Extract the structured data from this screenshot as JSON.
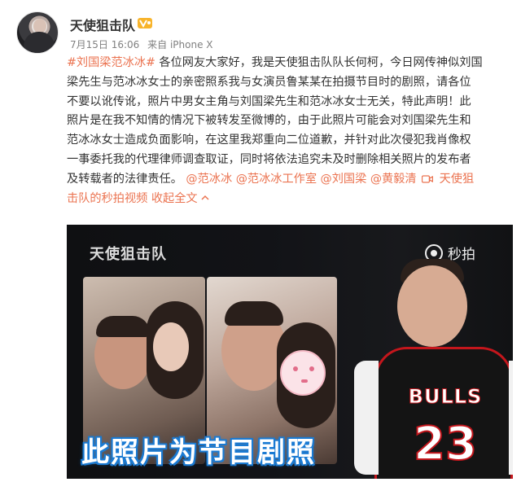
{
  "post": {
    "username": "天使狙击队",
    "vip_badge_icon": "yellow-vip-icon",
    "date": "7月15日 16:06",
    "source": "来自 iPhone X",
    "hashtag": "#刘国梁范冰冰#",
    "lines": [
      "各位网友大家好，我是天使狙击队队长何柯，今日网传神似刘国",
      "梁先生与范冰冰女士的亲密照系我与女演员鲁某某在拍摄节目时的剧照，请各位",
      "不要以讹传讹，照片中男女主角与刘国梁先生和范冰冰女士无关，特此声明！此",
      "照片是在我不知情的情况下被转发至微博的，由于此照片可能会对刘国梁先生和",
      "范冰冰女士造成负面影响，在这里我郑重向二位道歉，并针对此次侵犯我肖像权",
      "一事委托我的代理律师调查取证，同时将依法追究未及时删除相关照片的发布者",
      "及转载者的法律责任。"
    ],
    "mentions": [
      "@范冰冰",
      "@范冰冰工作室",
      "@刘国梁",
      "@黄毅清"
    ],
    "video_link_part1": "天使狙",
    "video_link_part2": "击队的秒拍视频",
    "collapse_label": "收起全文",
    "collapse_icon": "chevron-up-icon",
    "camera_icon": "video-camera-icon"
  },
  "media": {
    "watermark": "天使狙击队",
    "miaopai_label": "秒拍",
    "caption": "此照片为节目剧照",
    "jersey_text": "BULLS",
    "jersey_number": "23"
  }
}
